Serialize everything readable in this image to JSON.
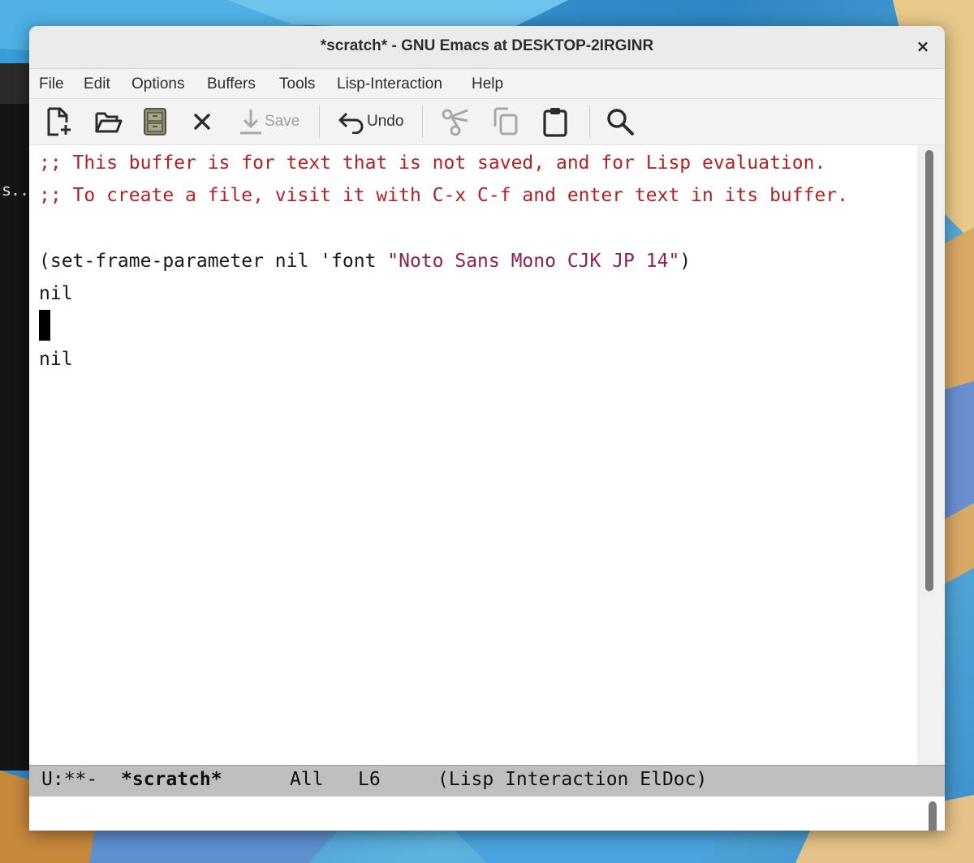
{
  "window": {
    "title": "*scratch* - GNU Emacs at DESKTOP-2IRGINR",
    "close_glyph": "×"
  },
  "background_terminal": {
    "text": "s.."
  },
  "menubar": {
    "items": [
      "File",
      "Edit",
      "Options",
      "Buffers",
      "Tools",
      "Lisp-Interaction",
      "Help"
    ]
  },
  "toolbar": {
    "save_label": "Save",
    "undo_label": "Undo",
    "icons": [
      "new-file-icon",
      "open-folder-icon",
      "dired-cabinet-icon",
      "close-buffer-icon",
      "save-icon",
      "undo-icon",
      "cut-icon",
      "copy-icon",
      "paste-icon",
      "search-icon"
    ]
  },
  "buffer": {
    "comment_line_1": ";; This buffer is for text that is not saved, and for Lisp evaluation.",
    "comment_line_2": ";; To create a file, visit it with C-x C-f and enter text in its buffer.",
    "code_prefix": "(set-frame-parameter nil 'font ",
    "code_string": "\"Noto Sans Mono CJK JP 14\"",
    "code_suffix": ")",
    "result_1": "nil",
    "result_2": "nil"
  },
  "modeline": {
    "status": "U:**-",
    "buffer_name": "*scratch*",
    "position": "All",
    "line": "L6",
    "modes": "(Lisp Interaction ElDoc)"
  },
  "colors": {
    "comment": "#b22222",
    "string": "#8b2252",
    "modeline_bg": "#bfbfbf",
    "desktop": "#3aa0d8"
  }
}
